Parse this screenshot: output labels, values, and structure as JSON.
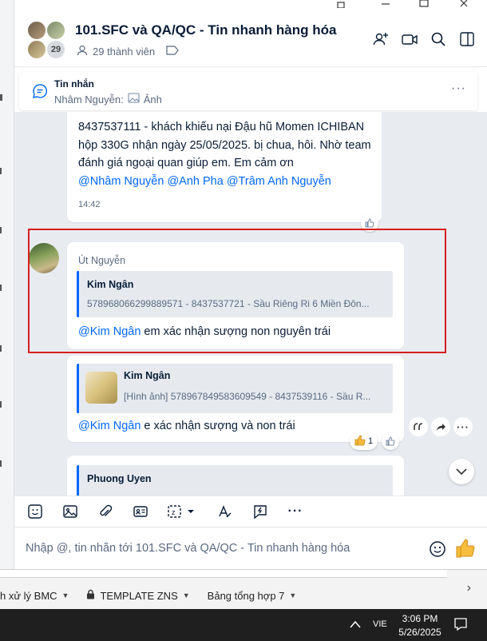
{
  "header": {
    "title": "101.SFC và QA/QC - Tin nhanh hàng hóa",
    "members": "29 thành viên",
    "member_badge": "29"
  },
  "pinned": {
    "title": "Tin nhắn",
    "sender": "Nhâm Nguyễn:",
    "content": "Ảnh"
  },
  "messages": {
    "m1": {
      "text": "8437537111 - khách khiếu nại Đậu hũ Momen ICHIBAN hộp 330G nhận ngày 25/05/2025.  bị chua, hôi. Nhờ team đánh giá ngoại quan giúp em. Em cảm ơn",
      "mention1": "@Nhâm Nguyễn",
      "mention2": "@Anh Pha",
      "mention3": "@Trâm Anh Nguyễn",
      "time": "14:42"
    },
    "m2": {
      "sender": "Út Nguyễn",
      "quote_name": "Kim Ngân",
      "quote_text": "578968066299889571 - 8437537721 - Sầu Riêng Ri 6 Miền Đôn...",
      "mention": "@Kim Ngân",
      "text": " em xác nhận sượng non nguyên trái"
    },
    "m3": {
      "quote_name": "Kim Ngân",
      "quote_text": "[Hình ảnh] 578967849583609549 - 8437539116 - Sầu R...",
      "mention": "@Kim Ngân",
      "text": " e xác nhận sượng và non trái",
      "reaction_count": "1"
    },
    "m4": {
      "quote_name": "Phuong Uyen"
    }
  },
  "composer": {
    "placeholder": "Nhập @, tin nhắn tới 101.SFC và QA/QC - Tin nhanh hàng hóa"
  },
  "sheet_tabs": [
    {
      "label": "h xử lý BMC"
    },
    {
      "label": "TEMPLATE ZNS"
    },
    {
      "label": "Bảng tổng hợp 7"
    }
  ],
  "taskbar": {
    "lang": "VIE",
    "time": "3:06 PM",
    "date": "5/26/2025"
  },
  "colors": {
    "accent": "#0068ff",
    "highlight": "#d81e1e"
  }
}
